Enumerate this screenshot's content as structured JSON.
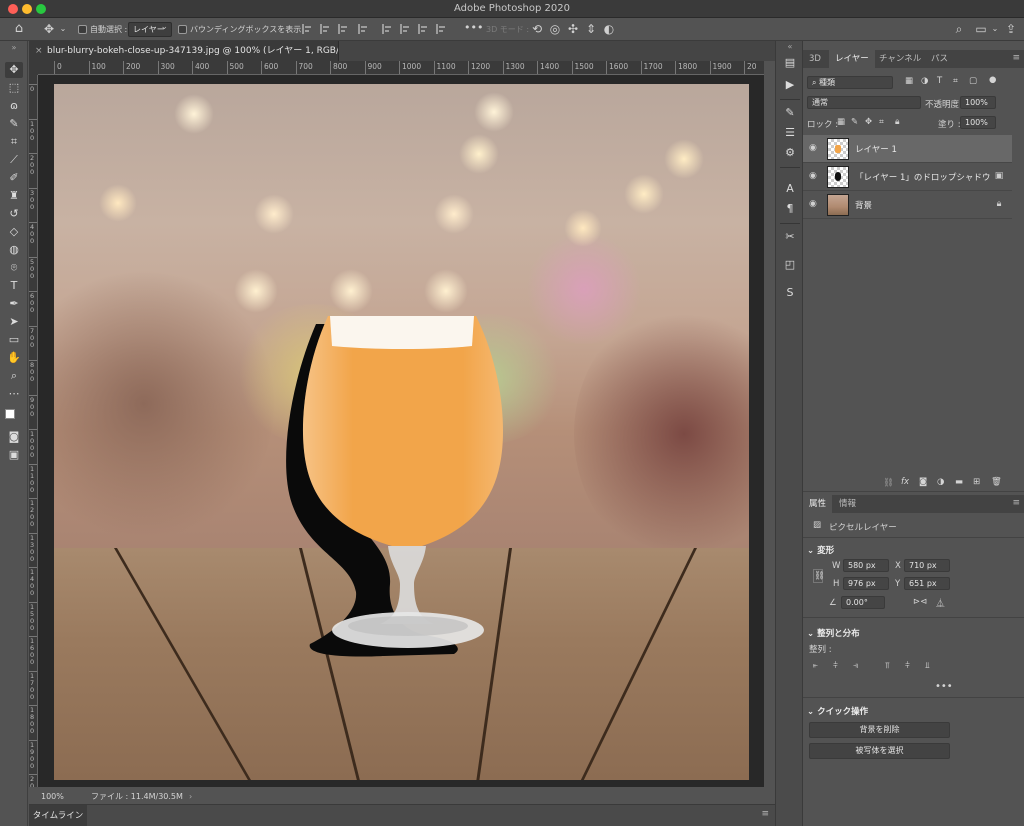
{
  "app": {
    "title": "Adobe Photoshop 2020"
  },
  "options_bar": {
    "auto_select_label": "自動選択 :",
    "auto_select_value": "レイヤー",
    "bounding_box_label": "バウンディングボックスを表示",
    "mode_3d_label": "3D モード :",
    "more": "•••"
  },
  "document": {
    "tab_title": "blur-blurry-bokeh-close-up-347139.jpg @ 100% (レイヤー 1, RGB/8) *",
    "close": "×",
    "zoom": "100%",
    "file_info": "ファイル : 11.4M/30.5M",
    "ruler_h": [
      "0",
      "100",
      "200",
      "300",
      "400",
      "500",
      "600",
      "700",
      "800",
      "900",
      "1000",
      "1100",
      "1200",
      "1300",
      "1400",
      "1500",
      "1600",
      "1700",
      "1800",
      "1900",
      "20"
    ],
    "ruler_v": [
      "0",
      "100",
      "200",
      "300",
      "400",
      "500",
      "600",
      "700",
      "800",
      "900",
      "1000",
      "1100",
      "1200",
      "1300",
      "1400",
      "1500",
      "1600",
      "1700",
      "1800",
      "1900",
      "2000"
    ]
  },
  "timeline": {
    "label": "タイムライン"
  },
  "layers_panel": {
    "tabs": [
      "3D",
      "レイヤー",
      "チャンネル",
      "パス"
    ],
    "filter_label": "種類",
    "blend_mode": "通常",
    "opacity_label": "不透明度 :",
    "opacity_value": "100%",
    "lock_label": "ロック :",
    "fill_label": "塗り :",
    "fill_value": "100%",
    "layers": [
      {
        "name": "レイヤー 1",
        "selected": true
      },
      {
        "name": "「レイヤー 1」のドロップシャドウ",
        "selected": false
      },
      {
        "name": "背景",
        "selected": false
      }
    ]
  },
  "properties_panel": {
    "tabs": [
      "属性",
      "情報"
    ],
    "layer_type": "ピクセルレイヤー",
    "transform_section": "変形",
    "w_label": "W",
    "w_value": "580 px",
    "h_label": "H",
    "h_value": "976 px",
    "x_label": "X",
    "x_value": "710 px",
    "y_label": "Y",
    "y_value": "651 px",
    "angle_value": "0.00°",
    "align_section": "整列と分布",
    "align_label": "整列 :",
    "quick_section": "クイック操作",
    "remove_bg": "背景を削除",
    "select_subject": "被写体を選択",
    "more": "•••"
  },
  "colors": {
    "accent_orange": "#f2a54a",
    "panel_bg": "#535353",
    "selected_layer": "#686868"
  }
}
